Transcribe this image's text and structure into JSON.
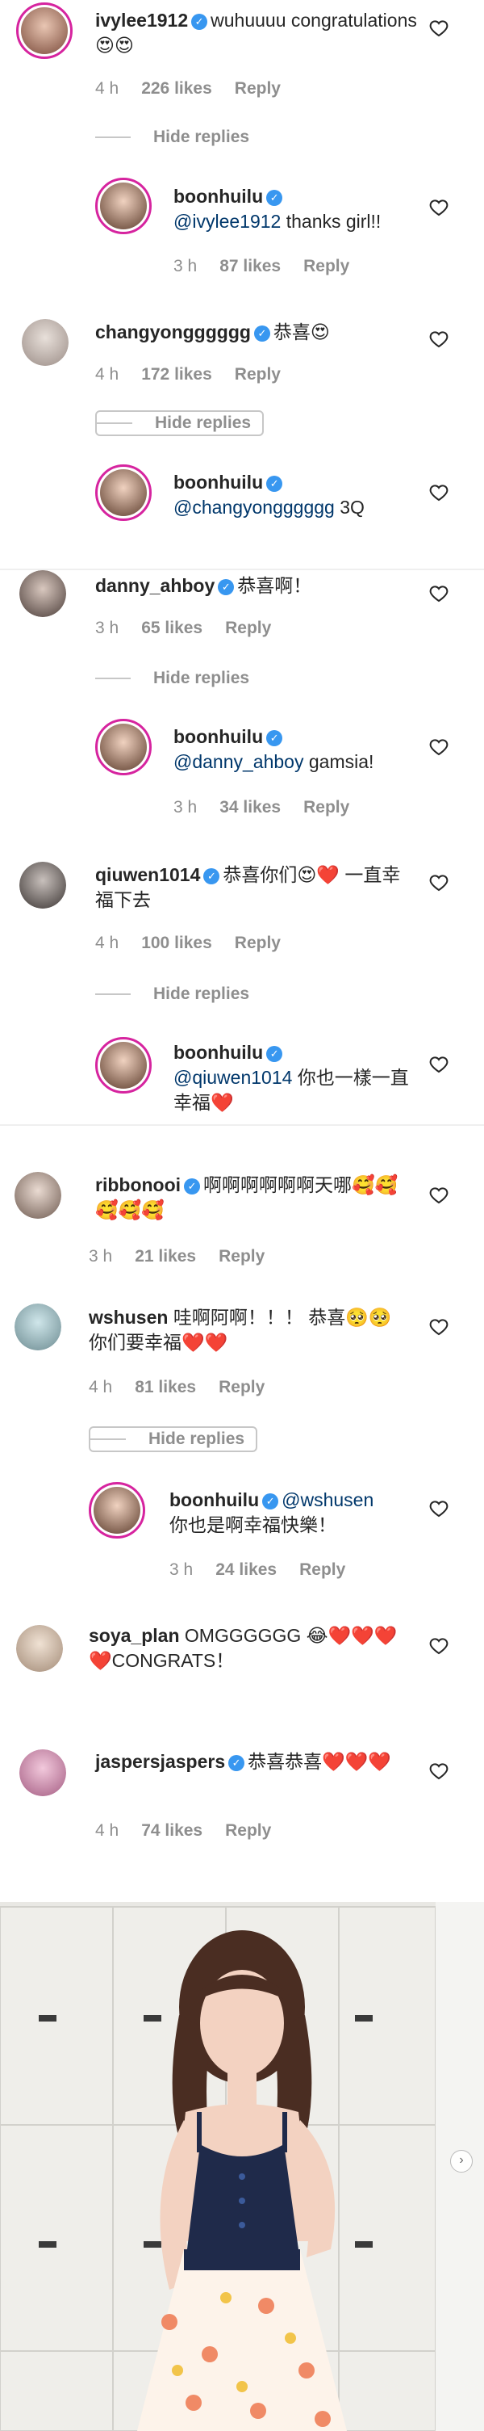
{
  "comments": [
    {
      "user": "ivylee1912",
      "text": "wuhuuuu congratulations 😍😍",
      "time": "4 h",
      "likes": "226 likes",
      "reply": "Reply"
    },
    {
      "user": "boonhuilu",
      "mention": "@ivylee1912",
      "text": " thanks girl!!",
      "time": "3 h",
      "likes": "87 likes",
      "reply": "Reply"
    },
    {
      "user": "changyongggggg",
      "text": "恭喜😍",
      "time": "4 h",
      "likes": "172 likes",
      "reply": "Reply"
    },
    {
      "user": "boonhuilu",
      "mention": "@changyongggggg",
      "text": " 3Q"
    },
    {
      "user": "danny_ahboy",
      "text": "恭喜啊！",
      "time": "3 h",
      "likes": "65 likes",
      "reply": "Reply"
    },
    {
      "user": "boonhuilu",
      "mention": "@danny_ahboy",
      "text": " gamsia!",
      "time": "3 h",
      "likes": "34 likes",
      "reply": "Reply"
    },
    {
      "user": "qiuwen1014",
      "text": "恭喜你们😍❤️ 一直幸福下去",
      "time": "4 h",
      "likes": "100 likes",
      "reply": "Reply"
    },
    {
      "user": "boonhuilu",
      "mention": "@qiuwen1014",
      "text": " 你也一樣一直幸福❤️"
    },
    {
      "user": "ribbonooi",
      "text": "啊啊啊啊啊啊天哪🥰🥰🥰🥰🥰",
      "time": "3 h",
      "likes": "21 likes",
      "reply": "Reply"
    },
    {
      "user": "wshusen",
      "text": "哇啊阿啊！！！ 恭喜🥺🥺 你们要幸福❤️❤️",
      "time": "4 h",
      "likes": "81 likes",
      "reply": "Reply"
    },
    {
      "user": "boonhuilu",
      "mention": "@wshusen",
      "text": " 你也是啊幸福快樂！",
      "time": "3 h",
      "likes": "24 likes",
      "reply": "Reply"
    },
    {
      "user": "soya_plan",
      "text": "OMGGGGGG 😂❤️❤️❤️❤️CONGRATS！"
    },
    {
      "user": "jaspersjaspers",
      "text": "恭喜恭喜❤️❤️❤️",
      "time": "4 h",
      "likes": "74 likes",
      "reply": "Reply"
    }
  ],
  "hide_replies": "Hide replies",
  "colors": {
    "verified": "#3897f0",
    "mention": "#00376b",
    "story_ring": "#d6249f",
    "meta": "#8e8e8e"
  },
  "icons": {
    "like": "heart-icon",
    "verified": "verified-badge-icon",
    "next": "chevron-right-icon"
  }
}
